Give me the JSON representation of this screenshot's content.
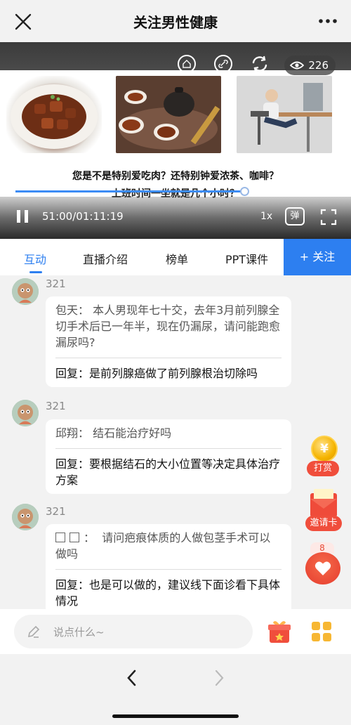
{
  "topbar": {
    "title": "关注男性健康"
  },
  "video": {
    "views": "226",
    "slide_line1": "您是不是特别爱吃肉？还特别钟爱浓茶、咖啡？",
    "slide_line2": "上班时间一坐就是几个小时？",
    "current_time": "51:00",
    "total_time": "01:11:19",
    "time_separator": "/",
    "progress_fraction": 0.714,
    "speed_label": "1x",
    "danmu_label": "弹"
  },
  "tabs": {
    "items": [
      {
        "label": "互动"
      },
      {
        "label": "直播介绍"
      },
      {
        "label": "榜单"
      },
      {
        "label": "PPT课件"
      }
    ],
    "active_index": 0,
    "follow_label": "+ 关注"
  },
  "comments": [
    {
      "user": "321",
      "question": "包天： 本人男现年七十交，去年3月前列腺全切手术后已一年半，现在仍漏尿，请问能跑愈漏尿吗?",
      "answer": "回复：是前列腺癌做了前列腺根治切除吗"
    },
    {
      "user": "321",
      "question": "邱翔： 结石能治疗好吗",
      "answer": "回复：要根据结石的大小位置等决定具体治疗方案"
    },
    {
      "user": "321",
      "question_name": "：",
      "question": "请问疤痕体质的人做包茎手术可以做吗",
      "answer": "回复：也是可以做的，建议线下面诊看下具体情况"
    }
  ],
  "widgets": {
    "reward_label": "打赏",
    "reward_coin_glyph": "¥",
    "invite_label": "邀请卡",
    "like_count": "8"
  },
  "input": {
    "placeholder": "说点什么~"
  },
  "colors": {
    "accent": "#2d7ff0",
    "red": "#f04e3c"
  }
}
